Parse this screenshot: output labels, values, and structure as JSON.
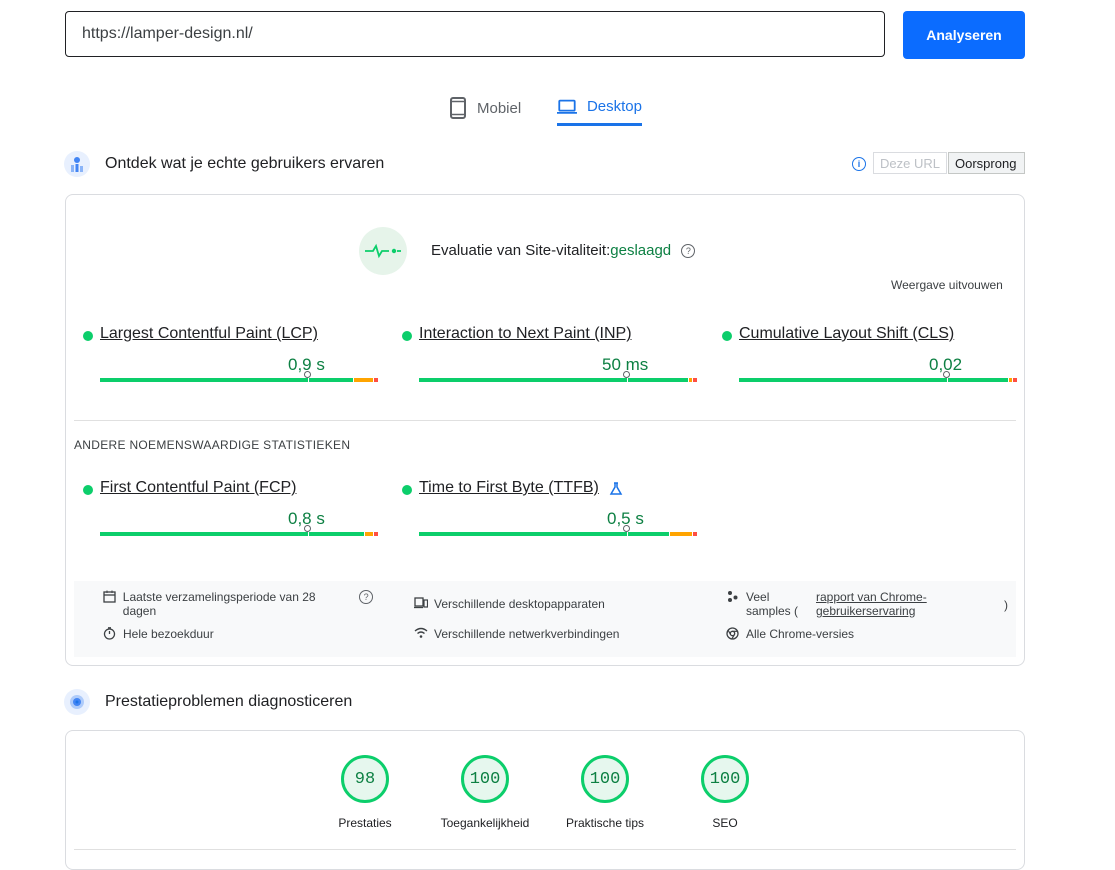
{
  "search": {
    "value": "https://lamper-design.nl/",
    "button_label": "Analyseren"
  },
  "tabs": [
    {
      "label": "Mobiel",
      "icon": "phone-icon",
      "active": false
    },
    {
      "label": "Desktop",
      "icon": "laptop-icon",
      "active": true
    }
  ],
  "crux": {
    "title": "Ontdek wat je echte gebruikers ervaren",
    "toggle_url": "Deze URL",
    "toggle_origin": "Oorsprong",
    "assessment_label": "Evaluatie van Site-vitaliteit:",
    "assessment_result": "geslaagd",
    "expand_label": "Weergave uitvouwen",
    "core_metrics": [
      {
        "name": "Largest Contentful Paint (LCP)",
        "value": "0,9 s",
        "good": 0.745,
        "ni": 0.07
      },
      {
        "name": "Interaction to Next Paint (INP)",
        "value": "50 ms",
        "good": 0.745,
        "ni": 0.01
      },
      {
        "name": "Cumulative Layout Shift (CLS)",
        "value": "0,02",
        "good": 0.745,
        "ni": 0.01
      }
    ],
    "other_title": "ANDERE NOEMENSWAARDIGE STATISTIEKEN",
    "other_metrics": [
      {
        "name": "First Contentful Paint (FCP)",
        "value": "0,8 s",
        "good": 0.745,
        "ni": 0.03,
        "experimental": false
      },
      {
        "name": "Time to First Byte (TTFB)",
        "value": "0,5 s",
        "good": 0.745,
        "ni": 0.08,
        "experimental": true
      }
    ],
    "footer": {
      "collection_period": "Laatste verzamelingsperiode van 28 dagen",
      "devices": "Verschillende desktopapparaten",
      "samples_prefix": "Veel samples (",
      "samples_link": "rapport van Chrome-gebruikerservaring",
      "samples_suffix": ")",
      "duration": "Hele bezoekduur",
      "network": "Verschillende netwerkverbindingen",
      "chrome_versions": "Alle Chrome-versies"
    }
  },
  "lighthouse": {
    "title": "Prestatieproblemen diagnosticeren",
    "scores": [
      {
        "value": "98",
        "label": "Prestaties"
      },
      {
        "value": "100",
        "label": "Toegankelijkheid"
      },
      {
        "value": "100",
        "label": "Praktische tips"
      },
      {
        "value": "100",
        "label": "SEO"
      }
    ]
  },
  "colors": {
    "accent": "#0b6cff",
    "good": "#0cce6b",
    "good_text": "#0d8043",
    "ni": "#ffa400",
    "poor": "#ff4e42"
  }
}
